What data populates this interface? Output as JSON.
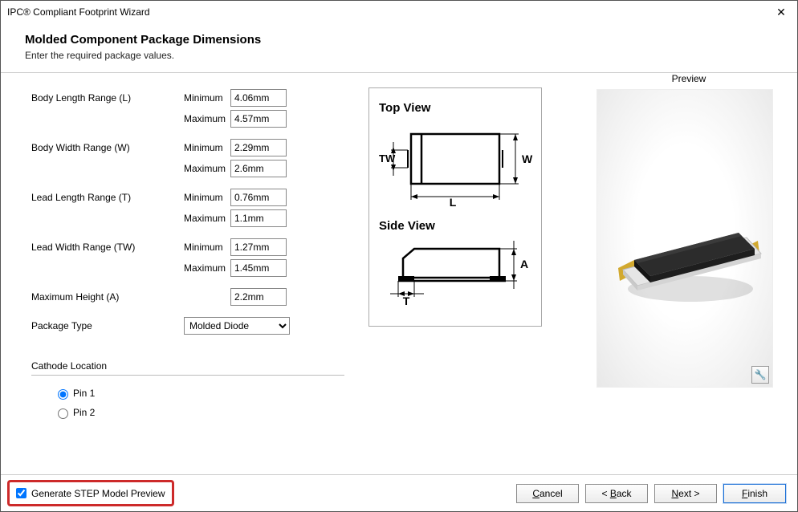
{
  "window": {
    "title": "IPC® Compliant Footprint Wizard"
  },
  "header": {
    "title": "Molded Component Package Dimensions",
    "subtitle": "Enter the required package values."
  },
  "labels": {
    "min": "Minimum",
    "max": "Maximum"
  },
  "fields": {
    "bodyLength": {
      "label": "Body Length Range (L)",
      "min": "4.06mm",
      "max": "4.57mm"
    },
    "bodyWidth": {
      "label": "Body Width Range (W)",
      "min": "2.29mm",
      "max": "2.6mm"
    },
    "leadLength": {
      "label": "Lead Length Range (T)",
      "min": "0.76mm",
      "max": "1.1mm"
    },
    "leadWidth": {
      "label": "Lead Width Range (TW)",
      "min": "1.27mm",
      "max": "1.45mm"
    },
    "maxHeight": {
      "label": "Maximum Height (A)",
      "value": "2.2mm"
    },
    "packageType": {
      "label": "Package Type",
      "value": "Molded Diode"
    }
  },
  "cathode": {
    "sectionLabel": "Cathode Location",
    "options": {
      "pin1": "Pin 1",
      "pin2": "Pin 2"
    },
    "selected": "pin1"
  },
  "diagram": {
    "topView": "Top View",
    "sideView": "Side View",
    "labels": {
      "L": "L",
      "W": "W",
      "TW": "TW",
      "T": "T",
      "A": "A"
    }
  },
  "preview": {
    "label": "Preview"
  },
  "footer": {
    "generateStep": "Generate STEP Model Preview",
    "cancel": "Cancel",
    "back": "Back",
    "next": "Next",
    "finish": "Finish"
  }
}
